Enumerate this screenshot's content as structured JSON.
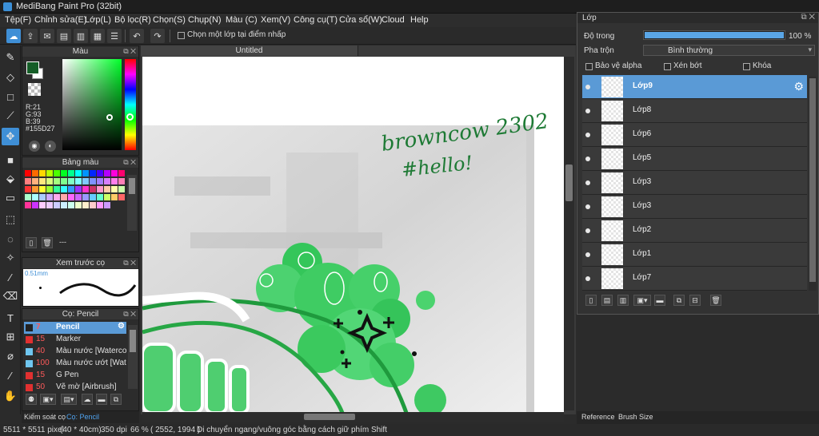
{
  "window": {
    "title": "MediBang Paint Pro (32bit)"
  },
  "menu": [
    "Tệp(F)",
    "Chỉnh sửa(E)",
    "Lớp(L)",
    "Bộ lọc(R)",
    "Chọn(S)",
    "Chụp(N)",
    "Màu (C)",
    "Xem(V)",
    "Công cụ(T)",
    "Cửa sổ(W)",
    "Cloud",
    "Help"
  ],
  "toolbar": {
    "checkbox_label": "Chọn một lớp tại điểm nhấp"
  },
  "document": {
    "tab_title": "Untitled"
  },
  "color_panel": {
    "title": "Màu",
    "r": "R:21",
    "g": "G:93",
    "b": "B:39",
    "hex": "#155D27",
    "fg_color": "#155d27"
  },
  "palette_panel": {
    "title": "Bảng màu",
    "footer_text": "---",
    "colors": [
      "#ff0000",
      "#ff6a00",
      "#ffd800",
      "#b6ff00",
      "#4cff00",
      "#00ff21",
      "#00ff90",
      "#00ffff",
      "#0094ff",
      "#0026ff",
      "#4800ff",
      "#b200ff",
      "#ff00dc",
      "#ff006e",
      "#ff7f7f",
      "#ffb27f",
      "#ffe97f",
      "#daff7f",
      "#a5ff7f",
      "#7fff8e",
      "#7fffc5",
      "#7fffff",
      "#7fc9ff",
      "#7f92ff",
      "#a17fff",
      "#d67fff",
      "#ff7fed",
      "#ff7fb6",
      "#ff3333",
      "#ff9933",
      "#ffff33",
      "#99ff33",
      "#33ff99",
      "#33ffff",
      "#3399ff",
      "#9933ff",
      "#ff33cc",
      "#cc3366",
      "#ff99cc",
      "#ffccaa",
      "#ffffaa",
      "#ccffaa",
      "#aaffcc",
      "#aaffff",
      "#aaccff",
      "#ccaaff",
      "#ffaaee",
      "#ffaaaa",
      "#ff66ff",
      "#cc66ff",
      "#9999ff",
      "#66ccff",
      "#66ffcc",
      "#ccff66",
      "#ffcc66",
      "#ff6666",
      "#ff3399",
      "#cc33ff",
      "#ffccff",
      "#eeccff",
      "#ccccff",
      "#cceeff",
      "#ccffee",
      "#eeffcc",
      "#ffeecc",
      "#ffcccc",
      "#ff99ff",
      "#cc99ff"
    ]
  },
  "preview_panel": {
    "title": "Xem trước cọ",
    "size": "0.51mm"
  },
  "brush_panel": {
    "title": "Cọ: Pencil",
    "items": [
      {
        "num": "7",
        "name": "Pencil",
        "color": "#222222",
        "selected": true
      },
      {
        "num": "15",
        "name": "Marker",
        "color": "#e03030"
      },
      {
        "num": "40",
        "name": "Màu nước [Watercolo",
        "color": "#6fc6f0"
      },
      {
        "num": "100",
        "name": "Màu nước ướt [Wate",
        "color": "#6fc6f0"
      },
      {
        "num": "15",
        "name": "G Pen",
        "color": "#e03030"
      },
      {
        "num": "50",
        "name": "Vẽ mờ [Airbrush]",
        "color": "#e03030"
      }
    ]
  },
  "left_tabs": [
    "Kiểm soát cọ",
    "Cọ: Pencil"
  ],
  "layer_panel": {
    "title": "Lớp",
    "opacity_label": "Độ trong",
    "opacity_value": "100 %",
    "opacity_fraction": 1.0,
    "blend_label": "Pha trộn",
    "blend_value": "Bình thường",
    "protect_alpha": "Bảo vệ alpha",
    "clipping": "Xén bớt",
    "lock": "Khóa",
    "layers": [
      "Lớp9",
      "Lớp8",
      "Lớp6",
      "Lớp5",
      "Lớp3",
      "Lớp3",
      "Lớp2",
      "Lớp1",
      "Lớp7"
    ]
  },
  "right_tabs": [
    "Reference",
    "Brush Size"
  ],
  "canvas_text": {
    "line1": "browncow 2302",
    "line2": "#hello!"
  },
  "status": {
    "size": "5511 * 5511 pixel",
    "cm": "(40 * 40cm)",
    "dpi": "350 dpi",
    "zoom": "66 %",
    "coords": "( 2552, 1994 )",
    "hint": "Di chuyển ngang/vuông góc bằng cách giữ phím Shift"
  }
}
